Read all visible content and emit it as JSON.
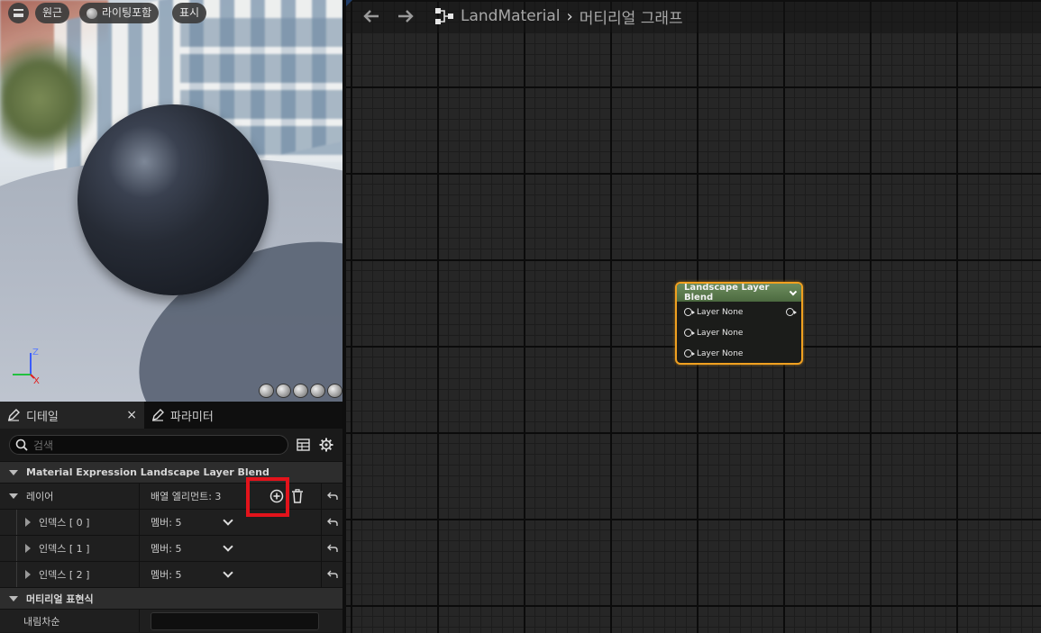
{
  "viewport": {
    "buttons": [
      {
        "label": "원근"
      },
      {
        "label": "라이팅포함"
      },
      {
        "label": "표시"
      }
    ],
    "axis": {
      "z": "Z",
      "x": "X"
    }
  },
  "details": {
    "tabs": [
      {
        "label": "디테일",
        "close": "×"
      },
      {
        "label": "파라미터"
      }
    ],
    "search": {
      "placeholder": "검색"
    },
    "category": "Material Expression Landscape Layer Blend",
    "layers": {
      "name": "레이어",
      "value": "배열 엘리먼트: 3",
      "items": [
        {
          "name": "인덱스 [ 0 ]",
          "value": "멤버: 5"
        },
        {
          "name": "인덱스 [ 1 ]",
          "value": "멤버: 5"
        },
        {
          "name": "인덱스 [ 2 ]",
          "value": "멤버: 5"
        }
      ]
    },
    "category2": "머티리얼 표현식",
    "desc_name": "내림차순"
  },
  "graph": {
    "breadcrumb": [
      "LandMaterial",
      "머티리얼 그래프"
    ],
    "node": {
      "title": "Landscape Layer Blend",
      "pins": [
        "Layer None",
        "Layer None",
        "Layer None"
      ]
    }
  },
  "colors": {
    "highlight": "#e3131b",
    "node_border": "#f0a020",
    "node_header": "#5b7a4d"
  }
}
